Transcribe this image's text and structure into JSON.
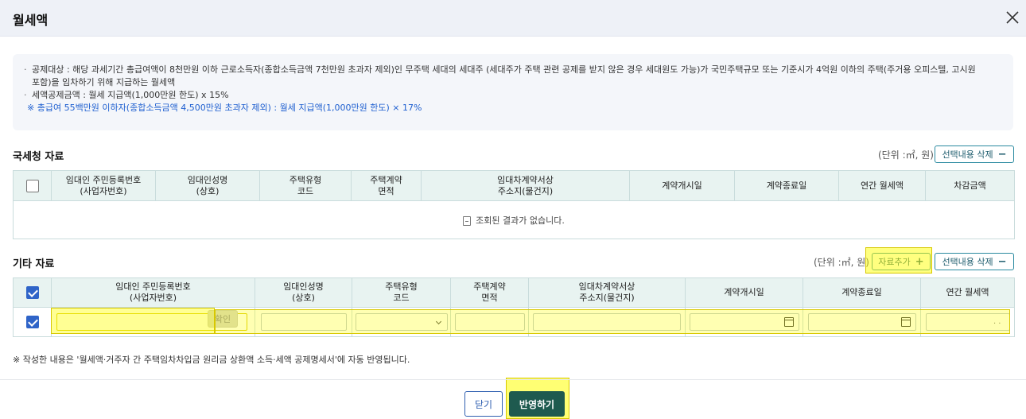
{
  "modal": {
    "title": "월세액"
  },
  "notice": {
    "line1": "공제대상 : 해당 과세기간 총급여액이 8천만원 이하 근로소득자(종합소득금액 7천만원 초과자 제외)인 무주택 세대의 세대주 (세대주가 주택 관련 공제를 받지 않은 경우 세대원도 가능)가 국민주택규모 또는 기준시가 4억원 이하의 주택(주거용 오피스텔, 고시원",
    "line1b": "포함)을 임차하기 위해 지급하는 월세액",
    "line2": "세액공제금액 : 월세 지급액(1,000만원 한도) x 15%",
    "line3": "※ 총급여 55백만원 이하자(종합소득금액 4,500만원 초과자 제외) : 월세 지급액(1,000만원 한도) × 17%"
  },
  "nts_section": {
    "title": "국세청 자료",
    "unit": "(단위 :㎡, 원)",
    "delete_label": "선택내용 삭제",
    "headers": [
      [
        "임대인 주민등록번호",
        "(사업자번호)"
      ],
      [
        "임대인성명",
        "(상호)"
      ],
      [
        "주택유형",
        "코드"
      ],
      [
        "주택계약",
        "면적"
      ],
      [
        "임대차계약서상",
        "주소지(물건지)"
      ],
      [
        "계약개시일"
      ],
      [
        "계약종료일"
      ],
      [
        "연간 월세액"
      ],
      [
        "차감금액"
      ]
    ],
    "empty_message": "조회된 결과가 없습니다."
  },
  "other_section": {
    "title": "기타 자료",
    "unit": "(단위 :㎡, 원)",
    "add_label": "자료추가",
    "delete_label": "선택내용 삭제",
    "headers": [
      [
        "임대인 주민등록번호",
        "(사업자번호)"
      ],
      [
        "임대인성명",
        "(상호)"
      ],
      [
        "주택유형",
        "코드"
      ],
      [
        "주택계약",
        "면적"
      ],
      [
        "임대차계약서상",
        "주소지(물건지)"
      ],
      [
        "계약개시일"
      ],
      [
        "계약종료일"
      ],
      [
        "연간 월세액"
      ]
    ],
    "confirm_label": "확인",
    "row_checked": true,
    "header_checked": true,
    "amount_value": ".     ."
  },
  "footnote": "※ 작성한 내용은 '월세액·거주자 간 주택임차차입금 원리금 상환액 소득·세액 공제명세서'에 자동 반영됩니다.",
  "buttons": {
    "close": "닫기",
    "apply": "반영하기"
  },
  "colors": {
    "accent": "#1e5a4f",
    "header_bg": "#e8f3f1",
    "highlight": "#ffff00"
  }
}
